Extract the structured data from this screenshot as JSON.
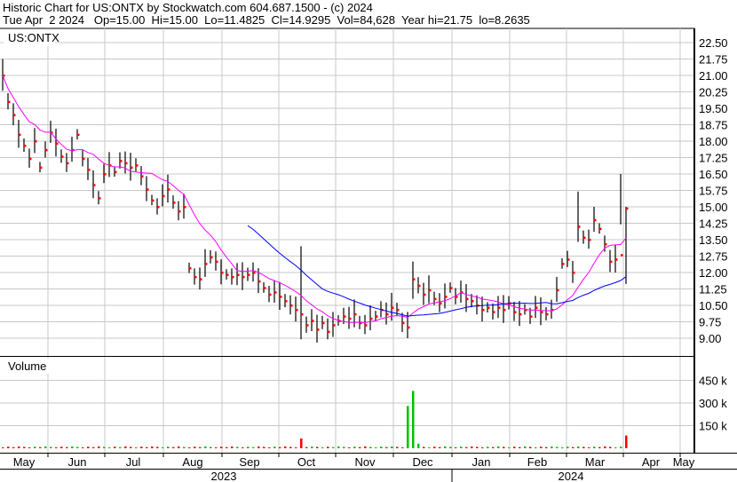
{
  "header": {
    "title": "Historic Chart for US:ONTX by Stockwatch.com 604.687.1500 - (c) 2024",
    "quote": "Tue Apr  2 2024   Op=15.00  Hi=15.00  Lo=11.4825  Cl=14.9295  Vol=84,628  Year hi=21.75  lo=8.2635"
  },
  "chart_data": {
    "type": "ohlc",
    "symbol": "US:ONTX",
    "volume_label": "Volume",
    "price_ticks": [
      "22.50",
      "21.75",
      "21.00",
      "20.25",
      "19.50",
      "18.75",
      "18.00",
      "17.25",
      "16.50",
      "15.75",
      "15.00",
      "14.25",
      "13.50",
      "12.75",
      "12.00",
      "11.25",
      "10.50",
      "9.75",
      "9.00"
    ],
    "price_range": [
      9.0,
      22.5
    ],
    "volume_ticks": [
      "450 k",
      "300 k",
      "150 k"
    ],
    "volume_tick_values": [
      450000,
      300000,
      150000
    ],
    "months": [
      "May",
      "Jun",
      "Jul",
      "Aug",
      "Sep",
      "Oct",
      "Nov",
      "Dec",
      "Jan",
      "Feb",
      "Mar",
      "Apr",
      "May"
    ],
    "years": [
      "2023",
      "2024"
    ],
    "close": [
      21.0,
      19.8,
      19.2,
      18.3,
      17.8,
      17.2,
      18.0,
      16.8,
      17.6,
      18.4,
      17.9,
      17.3,
      17.0,
      17.6,
      18.3,
      17.2,
      16.7,
      16.0,
      15.4,
      16.5,
      16.9,
      16.6,
      17.1,
      17.0,
      16.8,
      16.9,
      16.4,
      15.8,
      15.3,
      15.0,
      15.5,
      15.8,
      15.2,
      14.8,
      15.0,
      12.2,
      11.8,
      11.7,
      12.4,
      12.7,
      12.5,
      12.0,
      11.9,
      11.8,
      11.9,
      11.8,
      11.9,
      12.0,
      11.6,
      11.3,
      11.0,
      11.1,
      10.9,
      10.7,
      10.5,
      10.3,
      10.1,
      9.6,
      9.8,
      9.4,
      9.7,
      9.3,
      9.6,
      9.8,
      10.0,
      9.9,
      10.1,
      9.7,
      9.6,
      9.9,
      10.0,
      10.3,
      10.1,
      10.4,
      10.3,
      9.7,
      9.5,
      11.7,
      11.4,
      11.0,
      11.2,
      10.8,
      10.6,
      10.9,
      11.3,
      10.9,
      11.1,
      10.8,
      10.7,
      10.5,
      10.3,
      10.4,
      10.2,
      10.4,
      10.3,
      10.6,
      10.2,
      10.1,
      10.3,
      10.0,
      10.4,
      10.2,
      10.1,
      10.3,
      11.2,
      12.4,
      12.6,
      12.0,
      14.1,
      13.6,
      13.5,
      14.4,
      14.0,
      13.3,
      12.5,
      12.6,
      12.8,
      14.93
    ],
    "price_extremes": [
      {
        "bar": 0,
        "high": 21.75,
        "low": 20.3
      },
      {
        "bar": 56,
        "high": 13.2,
        "low": 8.95
      },
      {
        "bar": 61,
        "high": 9.9,
        "low": 8.95
      },
      {
        "bar": 77,
        "high": 12.5,
        "low": 10.8
      },
      {
        "bar": 76,
        "high": 10.2,
        "low": 9.0
      },
      {
        "bar": 108,
        "high": 15.7,
        "low": 13.4
      },
      {
        "bar": 116,
        "high": 16.5,
        "low": 14.2
      },
      {
        "bar": 117,
        "high": 15.0,
        "low": 11.48
      }
    ],
    "volume": [
      {
        "bar": 56,
        "value": 65000,
        "dir": "down"
      },
      {
        "bar": 76,
        "value": 280000,
        "dir": "up"
      },
      {
        "bar": 77,
        "value": 380000,
        "dir": "up"
      },
      {
        "bar": 78,
        "value": 30000,
        "dir": "up"
      },
      {
        "bar": 117,
        "value": 84628,
        "dir": "down"
      }
    ],
    "colors": {
      "bar": "#000000",
      "close_tick": "#ff0000",
      "ma_short": "#ff00ff",
      "ma_long": "#0000ff",
      "vol_up": "#00c000",
      "vol_down": "#ff0000",
      "grid": "#c8c8c8"
    }
  }
}
